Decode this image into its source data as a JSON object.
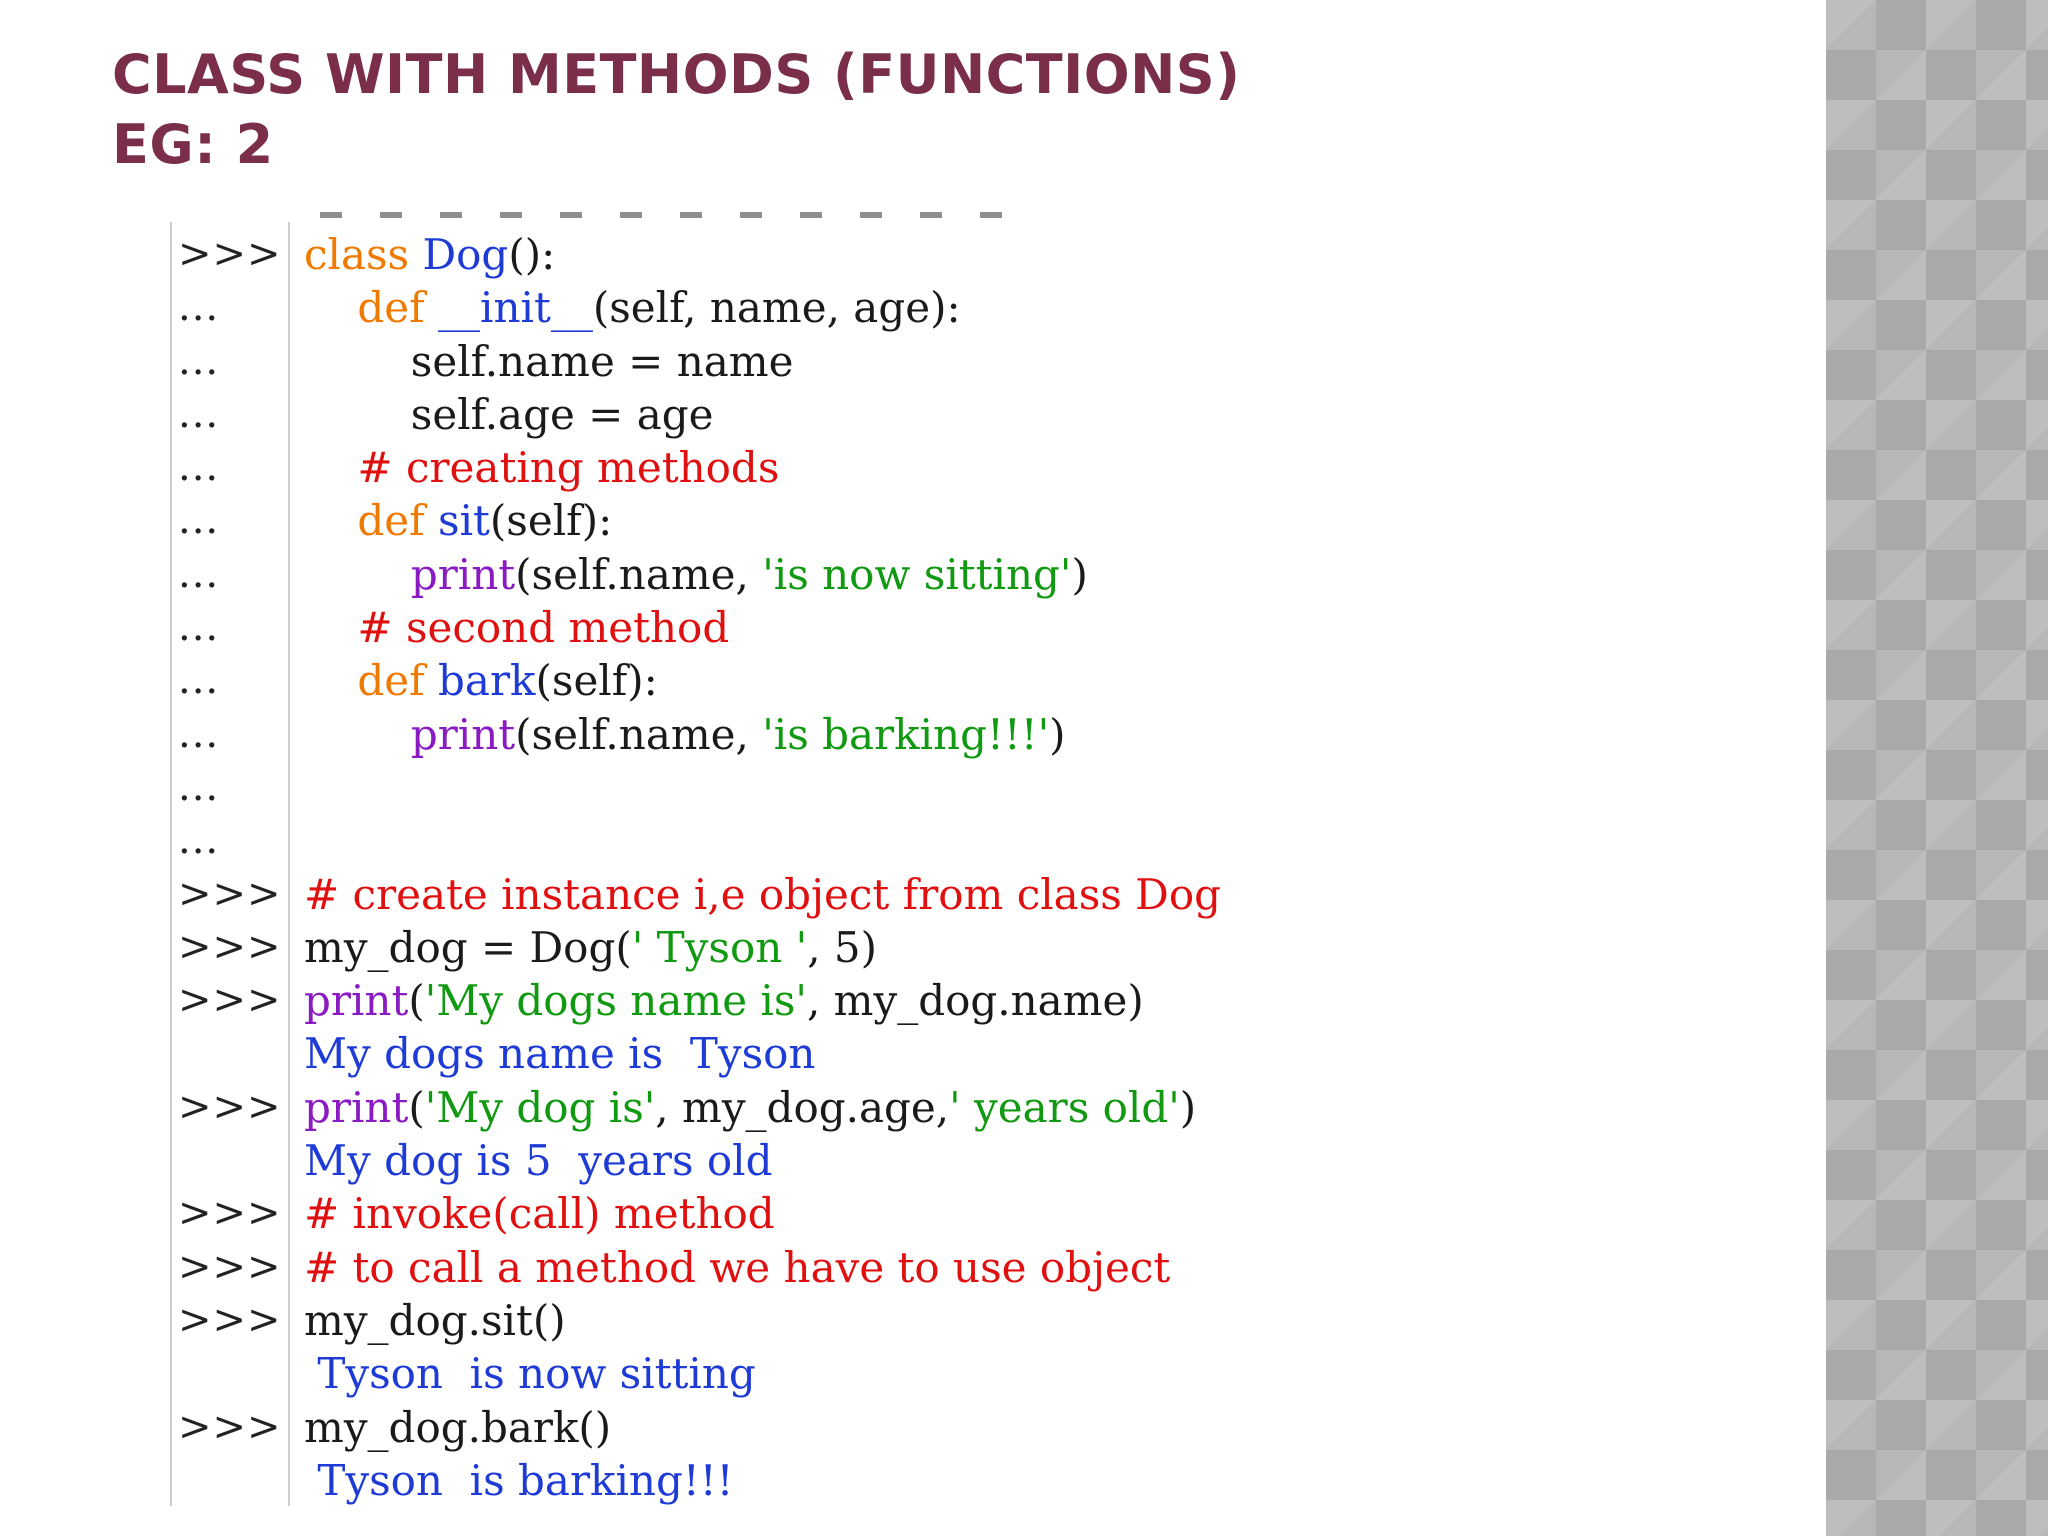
{
  "slide": {
    "title_line1": "CLASS WITH METHODS (FUNCTIONS)",
    "title_line2": "EG: 2"
  },
  "code": {
    "lines": [
      {
        "prompt": ">>>",
        "segments": [
          [
            "kw",
            "class "
          ],
          [
            "fn",
            "Dog"
          ],
          [
            "plain",
            "():"
          ]
        ]
      },
      {
        "prompt": "...",
        "segments": [
          [
            "plain",
            "    "
          ],
          [
            "kw",
            "def "
          ],
          [
            "fn",
            "__init__"
          ],
          [
            "plain",
            "(self, name, age):"
          ]
        ]
      },
      {
        "prompt": "...",
        "segments": [
          [
            "plain",
            "        self.name = name"
          ]
        ]
      },
      {
        "prompt": "...",
        "segments": [
          [
            "plain",
            "        self.age = age"
          ]
        ]
      },
      {
        "prompt": "...",
        "segments": [
          [
            "plain",
            "    "
          ],
          [
            "cm",
            "# creating methods"
          ]
        ]
      },
      {
        "prompt": "...",
        "segments": [
          [
            "plain",
            "    "
          ],
          [
            "kw",
            "def "
          ],
          [
            "fn",
            "sit"
          ],
          [
            "plain",
            "(self):"
          ]
        ]
      },
      {
        "prompt": "...",
        "segments": [
          [
            "plain",
            "        "
          ],
          [
            "bi",
            "print"
          ],
          [
            "plain",
            "(self.name, "
          ],
          [
            "str",
            "'is now sitting'"
          ],
          [
            "plain",
            ")"
          ]
        ]
      },
      {
        "prompt": "...",
        "segments": [
          [
            "plain",
            "    "
          ],
          [
            "cm",
            "# second method"
          ]
        ]
      },
      {
        "prompt": "...",
        "segments": [
          [
            "plain",
            "    "
          ],
          [
            "kw",
            "def "
          ],
          [
            "fn",
            "bark"
          ],
          [
            "plain",
            "(self):"
          ]
        ]
      },
      {
        "prompt": "...",
        "segments": [
          [
            "plain",
            "        "
          ],
          [
            "bi",
            "print"
          ],
          [
            "plain",
            "(self.name, "
          ],
          [
            "str",
            "'is barking!!!'"
          ],
          [
            "plain",
            ")"
          ]
        ]
      },
      {
        "prompt": "...",
        "segments": []
      },
      {
        "prompt": "...",
        "segments": []
      },
      {
        "prompt": ">>>",
        "segments": [
          [
            "cm",
            "# create instance i,e object from class Dog"
          ]
        ]
      },
      {
        "prompt": ">>>",
        "segments": [
          [
            "plain",
            "my_dog = Dog("
          ],
          [
            "str",
            "' Tyson '"
          ],
          [
            "plain",
            ", 5)"
          ]
        ]
      },
      {
        "prompt": ">>>",
        "segments": [
          [
            "bi",
            "print"
          ],
          [
            "plain",
            "("
          ],
          [
            "str",
            "'My dogs name is'"
          ],
          [
            "plain",
            ", my_dog.name)"
          ]
        ]
      },
      {
        "prompt": "",
        "segments": [
          [
            "out",
            "My dogs name is  Tyson"
          ]
        ]
      },
      {
        "prompt": ">>>",
        "segments": [
          [
            "bi",
            "print"
          ],
          [
            "plain",
            "("
          ],
          [
            "str",
            "'My dog is'"
          ],
          [
            "plain",
            ", my_dog.age,"
          ],
          [
            "str",
            "' years old'"
          ],
          [
            "plain",
            ")"
          ]
        ]
      },
      {
        "prompt": "",
        "segments": [
          [
            "out",
            "My dog is 5  years old"
          ]
        ]
      },
      {
        "prompt": ">>>",
        "segments": [
          [
            "cm",
            "# invoke(call) method"
          ]
        ]
      },
      {
        "prompt": ">>>",
        "segments": [
          [
            "cm",
            "# to call a method we have to use object"
          ]
        ]
      },
      {
        "prompt": ">>>",
        "segments": [
          [
            "plain",
            "my_dog.sit()"
          ]
        ]
      },
      {
        "prompt": "",
        "segments": [
          [
            "out",
            " Tyson  is now sitting"
          ]
        ]
      },
      {
        "prompt": ">>>",
        "segments": [
          [
            "plain",
            "my_dog.bark()"
          ]
        ]
      },
      {
        "prompt": "",
        "segments": [
          [
            "out",
            " Tyson  is barking!!!"
          ]
        ]
      }
    ]
  },
  "colors": {
    "title": "#7a2e49",
    "keyword": "#f07a00",
    "function_name": "#1f3bd6",
    "builtin": "#8a1ac2",
    "string": "#119a11",
    "comment": "#e01010",
    "output": "#1f3bd6"
  }
}
